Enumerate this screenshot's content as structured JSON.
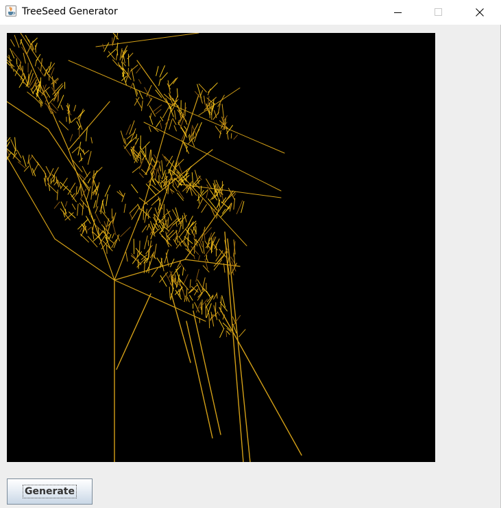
{
  "window": {
    "title": "TreeSeed Generator",
    "icon": "java-cup-icon"
  },
  "controls": {
    "minimize_icon": "minimize-icon",
    "maximize_icon": "maximize-icon",
    "close_icon": "close-icon"
  },
  "canvas": {
    "background": "#000000",
    "plant_color": "#d4a017",
    "plant_highlight": "#f2c31a",
    "plant_shadow": "#8a5a10"
  },
  "buttons": {
    "generate_label": "Generate"
  }
}
